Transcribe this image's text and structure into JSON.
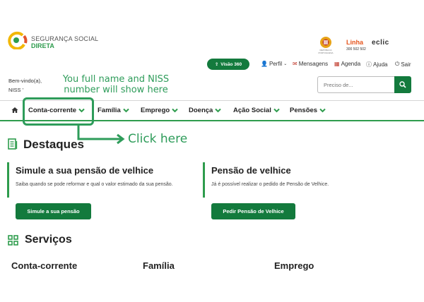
{
  "header": {
    "logo_line1": "SEGURANÇA SOCIAL",
    "logo_line2": "DIRETA",
    "partner_emblem_caption": "REPÚBLICA PORTUGUESA",
    "partner_linha": "Linha",
    "partner_linha_number": "300 502 502",
    "partner_eclic": "eclic"
  },
  "utility_bar": {
    "visao_label": "Visão 360",
    "perfil": "Perfil",
    "mensagens": "Mensagens",
    "agenda": "Agenda",
    "ajuda": "Ajuda",
    "sair": "Sair"
  },
  "user": {
    "welcome": "Bem-vindo(a),",
    "niss": "NISS '"
  },
  "annotations": {
    "name_hint": "You full name and NISS number will show here",
    "click_hint": "Click here"
  },
  "search": {
    "placeholder": "Preciso de..."
  },
  "nav": {
    "items": [
      "Conta-corrente",
      "Família",
      "Emprego",
      "Doença",
      "Ação Social",
      "Pensões"
    ]
  },
  "destaques": {
    "title": "Destaques",
    "cards": [
      {
        "title": "Simule a sua pensão de velhice",
        "text": "Saiba quando se pode reformar e qual o valor estimado da sua pensão.",
        "button": "Simule a sua pensão"
      },
      {
        "title": "Pensão de velhice",
        "text": "Já é possível realizar o pedido de Pensão de Velhice.",
        "button": "Pedir Pensão de Velhice"
      }
    ]
  },
  "servicos": {
    "title": "Serviços",
    "columns": [
      "Conta-corrente",
      "Família",
      "Emprego"
    ]
  },
  "colors": {
    "primary_green": "#137a3d",
    "accent_green": "#2e9c4d",
    "annotation_green": "#2e9c5a"
  }
}
